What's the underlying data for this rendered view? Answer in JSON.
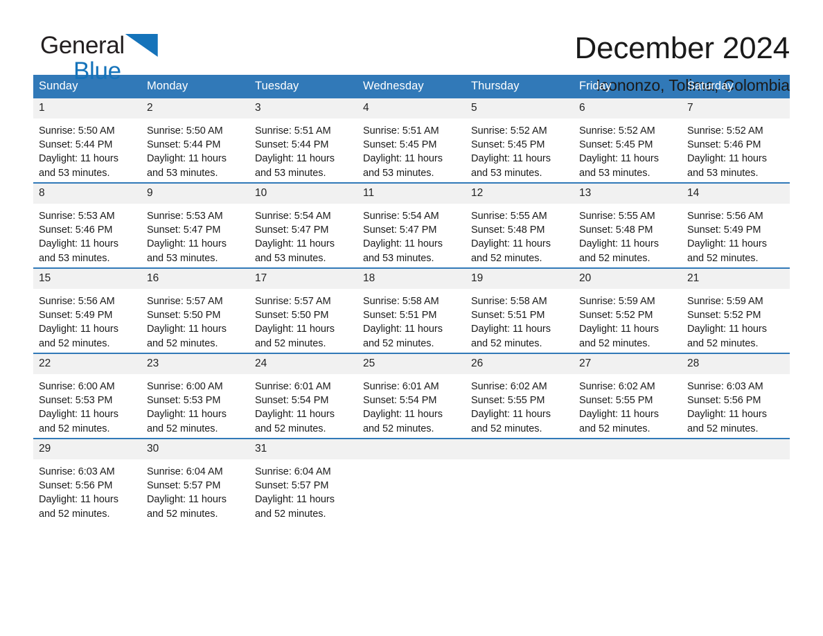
{
  "brand": {
    "name_part1": "General",
    "name_part2": "Blue",
    "triangle_icon": "blue-triangle-icon",
    "accent_color": "#1573ba"
  },
  "header": {
    "title": "December 2024",
    "subtitle": "Icononzo, Tolima, Colombia"
  },
  "theme": {
    "header_blue": "#3179b8",
    "row_divider_blue": "#3179b8",
    "daynum_band": "#f1f1f1",
    "page_background": "#ffffff",
    "text": "#1a1a1a"
  },
  "calendar": {
    "weekday_headers": [
      "Sunday",
      "Monday",
      "Tuesday",
      "Wednesday",
      "Thursday",
      "Friday",
      "Saturday"
    ],
    "weeks": [
      [
        {
          "day": "1",
          "sunrise": "Sunrise: 5:50 AM",
          "sunset": "Sunset: 5:44 PM",
          "daylight_1": "Daylight: 11 hours",
          "daylight_2": "and 53 minutes."
        },
        {
          "day": "2",
          "sunrise": "Sunrise: 5:50 AM",
          "sunset": "Sunset: 5:44 PM",
          "daylight_1": "Daylight: 11 hours",
          "daylight_2": "and 53 minutes."
        },
        {
          "day": "3",
          "sunrise": "Sunrise: 5:51 AM",
          "sunset": "Sunset: 5:44 PM",
          "daylight_1": "Daylight: 11 hours",
          "daylight_2": "and 53 minutes."
        },
        {
          "day": "4",
          "sunrise": "Sunrise: 5:51 AM",
          "sunset": "Sunset: 5:45 PM",
          "daylight_1": "Daylight: 11 hours",
          "daylight_2": "and 53 minutes."
        },
        {
          "day": "5",
          "sunrise": "Sunrise: 5:52 AM",
          "sunset": "Sunset: 5:45 PM",
          "daylight_1": "Daylight: 11 hours",
          "daylight_2": "and 53 minutes."
        },
        {
          "day": "6",
          "sunrise": "Sunrise: 5:52 AM",
          "sunset": "Sunset: 5:45 PM",
          "daylight_1": "Daylight: 11 hours",
          "daylight_2": "and 53 minutes."
        },
        {
          "day": "7",
          "sunrise": "Sunrise: 5:52 AM",
          "sunset": "Sunset: 5:46 PM",
          "daylight_1": "Daylight: 11 hours",
          "daylight_2": "and 53 minutes."
        }
      ],
      [
        {
          "day": "8",
          "sunrise": "Sunrise: 5:53 AM",
          "sunset": "Sunset: 5:46 PM",
          "daylight_1": "Daylight: 11 hours",
          "daylight_2": "and 53 minutes."
        },
        {
          "day": "9",
          "sunrise": "Sunrise: 5:53 AM",
          "sunset": "Sunset: 5:47 PM",
          "daylight_1": "Daylight: 11 hours",
          "daylight_2": "and 53 minutes."
        },
        {
          "day": "10",
          "sunrise": "Sunrise: 5:54 AM",
          "sunset": "Sunset: 5:47 PM",
          "daylight_1": "Daylight: 11 hours",
          "daylight_2": "and 53 minutes."
        },
        {
          "day": "11",
          "sunrise": "Sunrise: 5:54 AM",
          "sunset": "Sunset: 5:47 PM",
          "daylight_1": "Daylight: 11 hours",
          "daylight_2": "and 53 minutes."
        },
        {
          "day": "12",
          "sunrise": "Sunrise: 5:55 AM",
          "sunset": "Sunset: 5:48 PM",
          "daylight_1": "Daylight: 11 hours",
          "daylight_2": "and 52 minutes."
        },
        {
          "day": "13",
          "sunrise": "Sunrise: 5:55 AM",
          "sunset": "Sunset: 5:48 PM",
          "daylight_1": "Daylight: 11 hours",
          "daylight_2": "and 52 minutes."
        },
        {
          "day": "14",
          "sunrise": "Sunrise: 5:56 AM",
          "sunset": "Sunset: 5:49 PM",
          "daylight_1": "Daylight: 11 hours",
          "daylight_2": "and 52 minutes."
        }
      ],
      [
        {
          "day": "15",
          "sunrise": "Sunrise: 5:56 AM",
          "sunset": "Sunset: 5:49 PM",
          "daylight_1": "Daylight: 11 hours",
          "daylight_2": "and 52 minutes."
        },
        {
          "day": "16",
          "sunrise": "Sunrise: 5:57 AM",
          "sunset": "Sunset: 5:50 PM",
          "daylight_1": "Daylight: 11 hours",
          "daylight_2": "and 52 minutes."
        },
        {
          "day": "17",
          "sunrise": "Sunrise: 5:57 AM",
          "sunset": "Sunset: 5:50 PM",
          "daylight_1": "Daylight: 11 hours",
          "daylight_2": "and 52 minutes."
        },
        {
          "day": "18",
          "sunrise": "Sunrise: 5:58 AM",
          "sunset": "Sunset: 5:51 PM",
          "daylight_1": "Daylight: 11 hours",
          "daylight_2": "and 52 minutes."
        },
        {
          "day": "19",
          "sunrise": "Sunrise: 5:58 AM",
          "sunset": "Sunset: 5:51 PM",
          "daylight_1": "Daylight: 11 hours",
          "daylight_2": "and 52 minutes."
        },
        {
          "day": "20",
          "sunrise": "Sunrise: 5:59 AM",
          "sunset": "Sunset: 5:52 PM",
          "daylight_1": "Daylight: 11 hours",
          "daylight_2": "and 52 minutes."
        },
        {
          "day": "21",
          "sunrise": "Sunrise: 5:59 AM",
          "sunset": "Sunset: 5:52 PM",
          "daylight_1": "Daylight: 11 hours",
          "daylight_2": "and 52 minutes."
        }
      ],
      [
        {
          "day": "22",
          "sunrise": "Sunrise: 6:00 AM",
          "sunset": "Sunset: 5:53 PM",
          "daylight_1": "Daylight: 11 hours",
          "daylight_2": "and 52 minutes."
        },
        {
          "day": "23",
          "sunrise": "Sunrise: 6:00 AM",
          "sunset": "Sunset: 5:53 PM",
          "daylight_1": "Daylight: 11 hours",
          "daylight_2": "and 52 minutes."
        },
        {
          "day": "24",
          "sunrise": "Sunrise: 6:01 AM",
          "sunset": "Sunset: 5:54 PM",
          "daylight_1": "Daylight: 11 hours",
          "daylight_2": "and 52 minutes."
        },
        {
          "day": "25",
          "sunrise": "Sunrise: 6:01 AM",
          "sunset": "Sunset: 5:54 PM",
          "daylight_1": "Daylight: 11 hours",
          "daylight_2": "and 52 minutes."
        },
        {
          "day": "26",
          "sunrise": "Sunrise: 6:02 AM",
          "sunset": "Sunset: 5:55 PM",
          "daylight_1": "Daylight: 11 hours",
          "daylight_2": "and 52 minutes."
        },
        {
          "day": "27",
          "sunrise": "Sunrise: 6:02 AM",
          "sunset": "Sunset: 5:55 PM",
          "daylight_1": "Daylight: 11 hours",
          "daylight_2": "and 52 minutes."
        },
        {
          "day": "28",
          "sunrise": "Sunrise: 6:03 AM",
          "sunset": "Sunset: 5:56 PM",
          "daylight_1": "Daylight: 11 hours",
          "daylight_2": "and 52 minutes."
        }
      ],
      [
        {
          "day": "29",
          "sunrise": "Sunrise: 6:03 AM",
          "sunset": "Sunset: 5:56 PM",
          "daylight_1": "Daylight: 11 hours",
          "daylight_2": "and 52 minutes."
        },
        {
          "day": "30",
          "sunrise": "Sunrise: 6:04 AM",
          "sunset": "Sunset: 5:57 PM",
          "daylight_1": "Daylight: 11 hours",
          "daylight_2": "and 52 minutes."
        },
        {
          "day": "31",
          "sunrise": "Sunrise: 6:04 AM",
          "sunset": "Sunset: 5:57 PM",
          "daylight_1": "Daylight: 11 hours",
          "daylight_2": "and 52 minutes."
        },
        {
          "day": "",
          "sunrise": "",
          "sunset": "",
          "daylight_1": "",
          "daylight_2": ""
        },
        {
          "day": "",
          "sunrise": "",
          "sunset": "",
          "daylight_1": "",
          "daylight_2": ""
        },
        {
          "day": "",
          "sunrise": "",
          "sunset": "",
          "daylight_1": "",
          "daylight_2": ""
        },
        {
          "day": "",
          "sunrise": "",
          "sunset": "",
          "daylight_1": "",
          "daylight_2": ""
        }
      ]
    ]
  }
}
